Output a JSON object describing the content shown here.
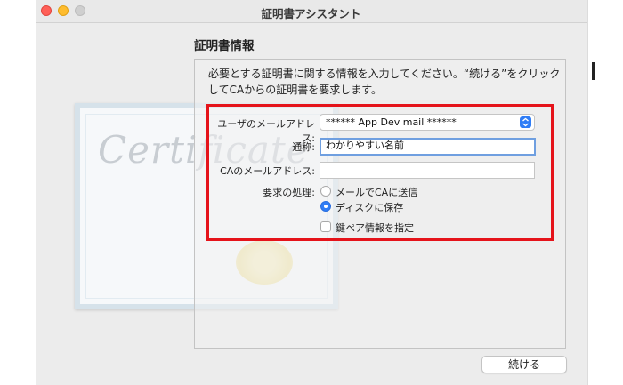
{
  "window": {
    "title": "証明書アシスタント",
    "section_title": "証明書情報",
    "description": "必要とする証明書に関する情報を入力してください。“続ける”をクリックしてCAからの証明書を要求します。"
  },
  "certificate_art": {
    "word": "Certificate"
  },
  "form": {
    "user_email_label": "ユーザのメールアドレス:",
    "user_email_value": "****** App Dev mail ******",
    "common_name_label": "通称:",
    "common_name_value": "わかりやすい名前",
    "ca_email_label": "CAのメールアドレス:",
    "ca_email_value": "",
    "request_label": "要求の処理:",
    "option_email": "メールでCAに送信",
    "option_disk": "ディスクに保存",
    "option_keypair": "鍵ペア情報を指定",
    "selected_option": "ディスクに保存",
    "keypair_checked": false
  },
  "buttons": {
    "continue": "続ける"
  },
  "colors": {
    "highlight": "#e5131a",
    "accent": "#2f7df6"
  }
}
